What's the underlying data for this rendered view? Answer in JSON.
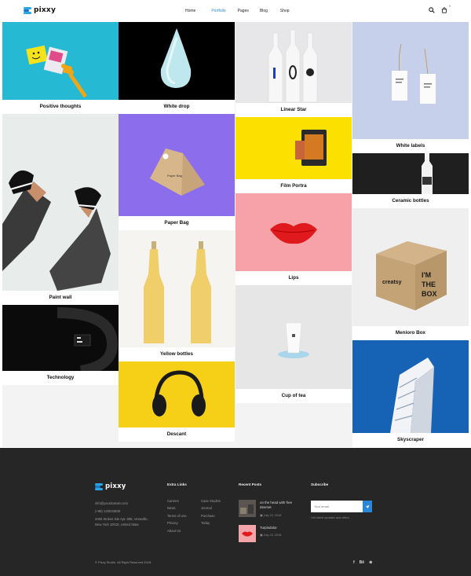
{
  "header": {
    "logo": "pixxy",
    "nav": [
      {
        "label": "Home",
        "active": false
      },
      {
        "label": "Portfolio",
        "active": true
      },
      {
        "label": "Pages",
        "active": false
      },
      {
        "label": "Blog",
        "active": false
      },
      {
        "label": "Shop",
        "active": false
      }
    ],
    "cart_count": "0",
    "accent": "#2a8fd6"
  },
  "portfolio": {
    "col1": [
      "Positive thoughts",
      "Paint wall",
      "Technology"
    ],
    "col2": [
      "White drop",
      "Paper Bag",
      "Yellow bottles",
      "Descant"
    ],
    "col3": [
      "Linear Star",
      "Film Portra",
      "Lips",
      "Cup of tea"
    ],
    "col4": [
      "White labels",
      "Ceramic bottles",
      "Menioro Box",
      "Skyscraper"
    ]
  },
  "footer": {
    "logo": "pixxy",
    "email": "info@yourdomain.com",
    "phone": "(+88) 120034509",
    "address": "2005 Stokes Isle Apt. 896, Venaville, New York 10010, United State",
    "extra_links_heading": "Extra Links",
    "links_col1": [
      "Careers",
      "News",
      "Terms of Use",
      "Privacy",
      "About Us"
    ],
    "links_col2": [
      "Case Studies",
      "Journal",
      "Purchase",
      "Today"
    ],
    "recent_posts_heading": "Recent Posts",
    "posts": [
      {
        "title": "on the head with free internet",
        "date": "July 23, 2018"
      },
      {
        "title": "Turpisdolor",
        "date": "July 23, 2018"
      }
    ],
    "subscribe_heading": "Subscribe",
    "subscribe_placeholder": "Your email",
    "subscribe_note": "Get latest updates and offers.",
    "copyright": "© Pixxy Studio. All Right Reserved 2018.",
    "social": [
      "f",
      "Bē",
      "⊛"
    ]
  }
}
